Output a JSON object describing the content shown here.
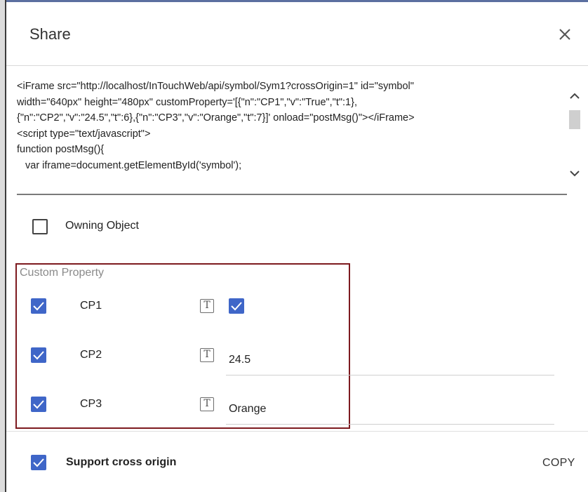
{
  "dialog": {
    "title": "Share",
    "close_icon": "close-icon"
  },
  "code": {
    "lines": [
      "<iFrame src=\"http://localhost/InTouchWeb/api/symbol/Sym1?crossOrigin=1\" id=\"symbol\"",
      "width=\"640px\" height=\"480px\" customProperty='[{\"n\":\"CP1\",\"v\":\"True\",\"t\":1},",
      "{\"n\":\"CP2\",\"v\":\"24.5\",\"t\":6},{\"n\":\"CP3\",\"v\":\"Orange\",\"t\":7}]' onload=\"postMsg()\"></iFrame>",
      "<script type=\"text/javascript\">",
      "function postMsg(){",
      "    var iframe=document.getElementById('symbol');"
    ]
  },
  "owning_object": {
    "label": "Owning Object",
    "checked": false
  },
  "custom_property": {
    "title": "Custom Property",
    "items": [
      {
        "name": "CP1",
        "checked": true,
        "type_icon": "text-type-icon",
        "value_checked": true
      },
      {
        "name": "CP2",
        "checked": true,
        "type_icon": "text-type-icon",
        "value": "24.5"
      },
      {
        "name": "CP3",
        "checked": true,
        "type_icon": "text-type-icon",
        "value": "Orange"
      }
    ]
  },
  "footer": {
    "support_cross_origin": {
      "label": "Support cross origin",
      "checked": true
    },
    "copy_label": "COPY"
  },
  "colors": {
    "checkbox_blue": "#3f66c8",
    "highlight_border": "#7d1a1f"
  }
}
